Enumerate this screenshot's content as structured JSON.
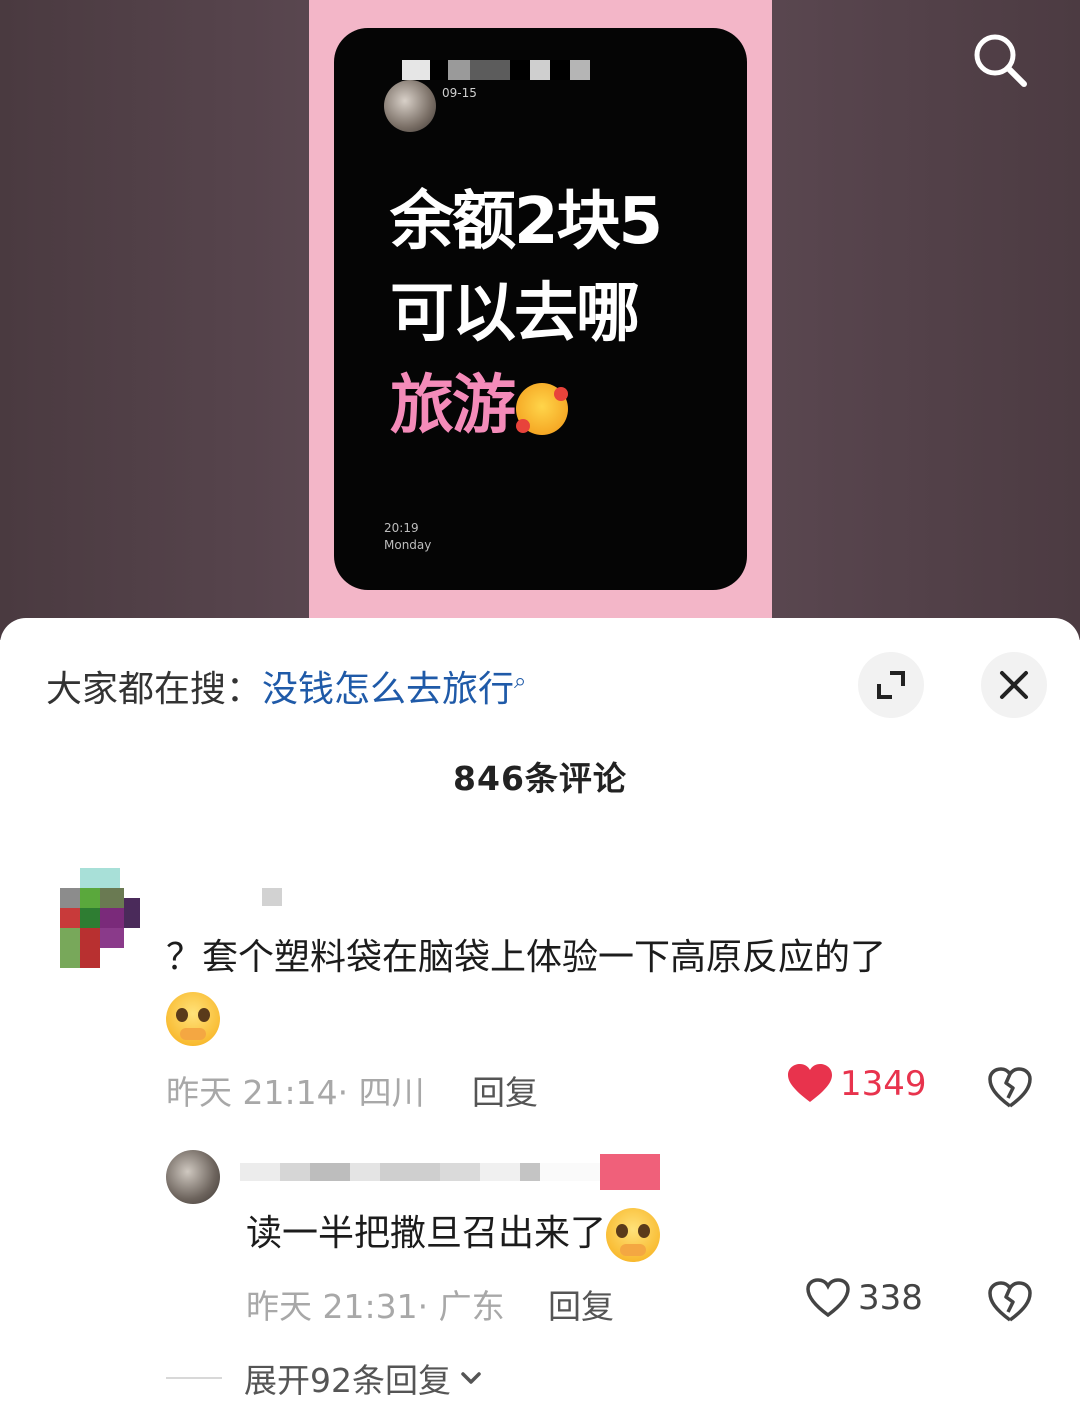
{
  "post": {
    "date": "09-15",
    "line1": "余额2块5",
    "line2": "可以去哪",
    "line3": "旅游",
    "time": "20:19",
    "weekday": "Monday"
  },
  "sheet": {
    "search_prefix": "大家都在搜：",
    "search_keyword": "没钱怎么去旅行",
    "comment_count_title": "846条评论"
  },
  "comments": [
    {
      "text": "？套个塑料袋在脑袋上体验一下高原反应的了",
      "time": "昨天 21:14",
      "location": "· 四川",
      "reply_label": "回复",
      "likes": "1349",
      "liked": true
    }
  ],
  "reply": {
    "text": "读一半把撒旦召出来了",
    "time": "昨天 21:31",
    "location": "· 广东",
    "reply_label": "回复",
    "likes": "338",
    "liked": false
  },
  "expand_replies_label": "展开92条回复",
  "colors": {
    "accent_pink": "#f48bb9",
    "like_red": "#e8334d",
    "keyword_blue": "#1f5aa8"
  },
  "icons": [
    "search-icon",
    "expand-icon",
    "close-icon",
    "heart-filled-icon",
    "heart-outline-icon",
    "broken-heart-icon",
    "chevron-down-icon"
  ]
}
